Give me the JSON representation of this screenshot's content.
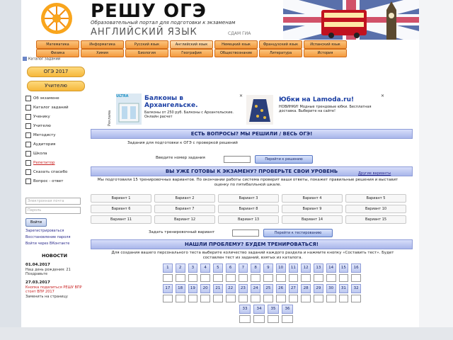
{
  "header": {
    "title": "РЕШУ ОГЭ",
    "subtitle": "Образовательный портал для подготовки к экзаменам",
    "subject": "АНГЛИЙСКИЙ ЯЗЫК",
    "sound": "СДАМ ГИА"
  },
  "nav": {
    "row1": [
      "Математика",
      "Информатика",
      "Русский язык",
      "Английский язык",
      "Немецкий язык",
      "Французский язык",
      "Испанский язык"
    ],
    "row2": [
      "Физика",
      "Химия",
      "Биология",
      "География",
      "Обществознание",
      "Литература",
      "История"
    ]
  },
  "sidebar": {
    "top_link": "Каталог заданий",
    "year_button": "ОГЭ 2017",
    "second_button": "Учителю",
    "items": [
      {
        "label": "Об экзамене",
        "red": false
      },
      {
        "label": "Каталог заданий",
        "red": false
      },
      {
        "label": "Ученику",
        "red": false
      },
      {
        "label": "Учителю",
        "red": false
      },
      {
        "label": "Методисту",
        "red": false
      },
      {
        "label": "Аудитория",
        "red": false
      },
      {
        "label": "Школа",
        "red": false
      },
      {
        "label": "Репетитор",
        "red": true
      },
      {
        "label": "Сказать спасибо",
        "red": false
      },
      {
        "label": "Вопрос - ответ",
        "red": false
      }
    ],
    "login_placeholder": "Электронная почта",
    "password_placeholder": "Пароль",
    "login_button": "Войти",
    "register_link": "Зарегистрироваться",
    "restore_link": "Восстановление пароля",
    "vk_link": "Войти через ВКонтакте",
    "news_title": "НОВОСТИ",
    "news": [
      {
        "date": "01.04.2017",
        "text": "Наш день рождения: 21 Поздравьте",
        "red": false
      },
      {
        "date": "27.03.2017",
        "text": "Кнопка поделиться РЕШУ ВПР стоят ВПР 2017",
        "red": true
      },
      {
        "date": "",
        "text": "Заменить на страницу",
        "red": false
      }
    ]
  },
  "ads": [
    {
      "brand": "ULTRA",
      "title": "Балконы в Архангельске.",
      "text": "Балконы от 250 руб. Балконы с Архангельские. Онлайн расчет",
      "side": "Реклама"
    },
    {
      "brand": "",
      "title": "Юбки на Lamoda.ru!",
      "text": "НОВИНКИ! Модные трендовые юбки. Бесплатная доставка. Выберите на сайте!",
      "side": ""
    }
  ],
  "main": {
    "section1": "ЕСТЬ ВОПРОСЫ? МЫ РЕШИЛИ / ВЕСЬ ОГЭ!",
    "section1_note": "Задания для подготовки к ОГЭ с проверкой решений",
    "task_label": "Введите номер задания",
    "task_button": "Перейти к решению",
    "section2": "ВЫ УЖЕ ГОТОВЫ К ЭКЗАМЕНУ? ПРОВЕРЬТЕ СВОИ УРОВЕНЬ",
    "section2_link": "Другие варианты",
    "section2_text": "Мы подготовили 15 тренировочных вариантов. По окончании работы система проверит ваши ответы, покажет правильные решения и выставит оценку по пятибалльной шкале.",
    "variants": [
      "Вариант 1",
      "Вариант 2",
      "Вариант 3",
      "Вариант 4",
      "Вариант 5",
      "Вариант 6",
      "Вариант 7",
      "Вариант 8",
      "Вариант 9",
      "Вариант 10",
      "Вариант 11",
      "Вариант 12",
      "Вариант 13",
      "Вариант 14",
      "Вариант 15"
    ],
    "variant_label": "Задать тренировочный вариант",
    "variant_button": "Перейти к тестированию",
    "section3": "НАШЛИ ПРОБЛЕМУ? БУДЕМ ТРЕНИРОВАТЬСЯ!",
    "section3_text": "Для создания вашего персонального теста выберите количество заданий каждого раздела и нажмите кнопку «Составить тест». Будет составлен тест из заданий, взятых из каталога.",
    "numbers_row1": [
      "1",
      "2",
      "3",
      "4",
      "5",
      "6",
      "7",
      "8",
      "9",
      "10",
      "11",
      "12",
      "13",
      "14",
      "15",
      "16"
    ],
    "numbers_row2": [
      "17",
      "18",
      "19",
      "20",
      "21",
      "22",
      "23",
      "24",
      "25",
      "26",
      "27",
      "28",
      "29",
      "30",
      "31",
      "32"
    ],
    "numbers_row3": [
      "33",
      "34",
      "35",
      "36"
    ]
  },
  "colors": {
    "accent": "#f49a3c",
    "section": "#a9b6ea",
    "link": "#2a2a8c",
    "alert": "#c81e1e"
  }
}
